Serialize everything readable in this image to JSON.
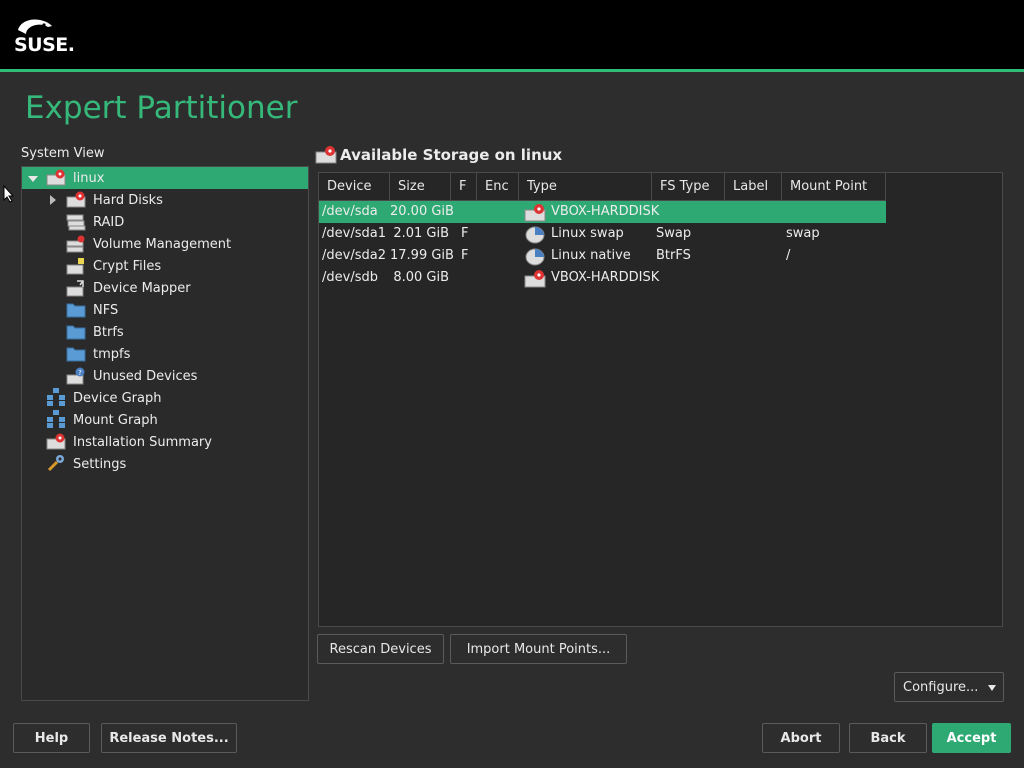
{
  "header": {
    "logo_text": "SUSE."
  },
  "page": {
    "title": "Expert Partitioner"
  },
  "sidebar": {
    "label": "System View",
    "items": [
      {
        "label": "linux",
        "icon": "disk-icon"
      },
      {
        "label": "Hard Disks",
        "icon": "disk-icon"
      },
      {
        "label": "RAID",
        "icon": "raid-icon"
      },
      {
        "label": "Volume Management",
        "icon": "lvm-icon"
      },
      {
        "label": "Crypt Files",
        "icon": "crypt-icon"
      },
      {
        "label": "Device Mapper",
        "icon": "device-mapper-icon"
      },
      {
        "label": "NFS",
        "icon": "folder-icon"
      },
      {
        "label": "Btrfs",
        "icon": "folder-icon"
      },
      {
        "label": "tmpfs",
        "icon": "folder-icon"
      },
      {
        "label": "Unused Devices",
        "icon": "unused-icon"
      },
      {
        "label": "Device Graph",
        "icon": "graph-icon"
      },
      {
        "label": "Mount Graph",
        "icon": "graph-icon"
      },
      {
        "label": "Installation Summary",
        "icon": "disk-icon"
      },
      {
        "label": "Settings",
        "icon": "wrench-icon"
      }
    ]
  },
  "storage": {
    "title": "Available Storage on linux",
    "columns": [
      "Device",
      "Size",
      "F",
      "Enc",
      "Type",
      "FS Type",
      "Label",
      "Mount Point"
    ],
    "rows": [
      {
        "device": "/dev/sda",
        "size": "20.00 GiB",
        "f": "",
        "enc": "",
        "type": "VBOX-HARDDISK",
        "fs": "",
        "label": "",
        "mount": ""
      },
      {
        "device": "/dev/sda1",
        "size": "2.01 GiB",
        "f": "F",
        "enc": "",
        "type": "Linux swap",
        "fs": "Swap",
        "label": "",
        "mount": "swap"
      },
      {
        "device": "/dev/sda2",
        "size": "17.99 GiB",
        "f": "F",
        "enc": "",
        "type": "Linux native",
        "fs": "BtrFS",
        "label": "",
        "mount": "/"
      },
      {
        "device": "/dev/sdb",
        "size": "8.00 GiB",
        "f": "",
        "enc": "",
        "type": "VBOX-HARDDISK",
        "fs": "",
        "label": "",
        "mount": ""
      }
    ]
  },
  "buttons": {
    "rescan": "Rescan Devices",
    "import": "Import Mount Points...",
    "configure": "Configure...",
    "help": "Help",
    "release_notes": "Release Notes...",
    "abort": "Abort",
    "back": "Back",
    "accept": "Accept"
  },
  "colors": {
    "accent": "#2fa973",
    "title": "#35b879",
    "topbar": "#000000"
  }
}
